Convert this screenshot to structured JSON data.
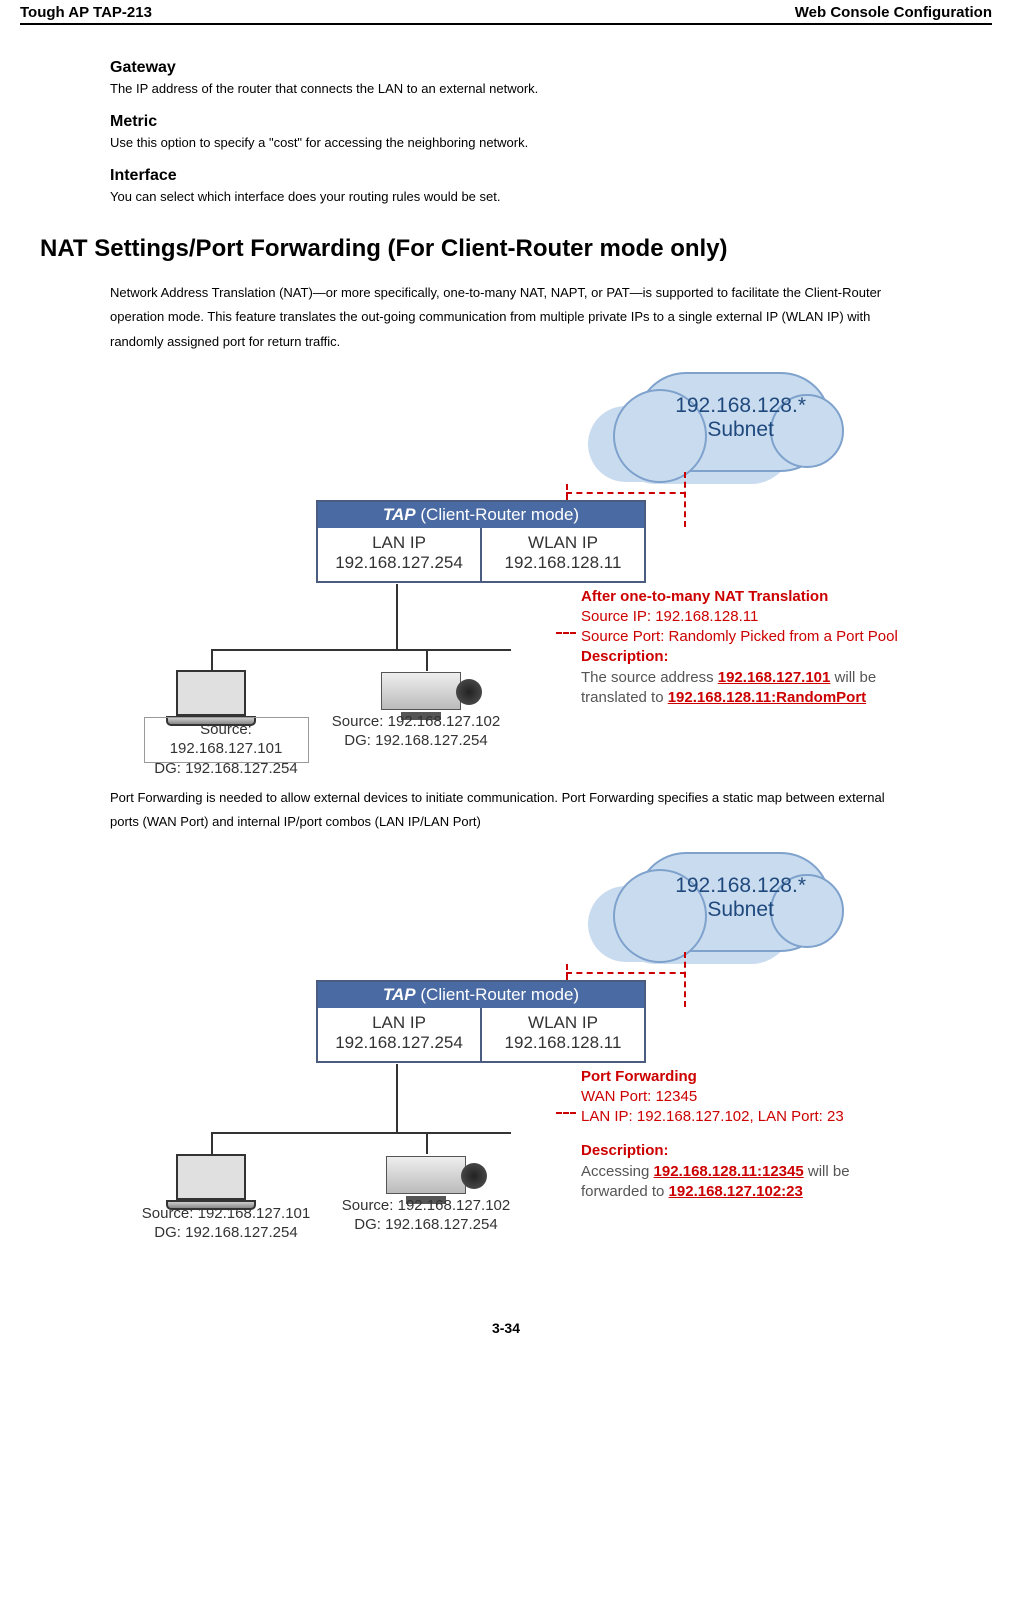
{
  "header": {
    "left": "Tough AP TAP-213",
    "right": "Web Console Configuration"
  },
  "sections": {
    "gateway": {
      "title": "Gateway",
      "text": "The IP address of the router that connects the LAN to an external network."
    },
    "metric": {
      "title": "Metric",
      "text": "Use this option to specify a \"cost\" for accessing the neighboring network."
    },
    "interface": {
      "title": "Interface",
      "text": "You can select which interface does your routing rules would be set."
    }
  },
  "main_heading": "NAT Settings/Port Forwarding (For Client-Router mode only)",
  "para1": "Network Address Translation (NAT)—or more specifically, one-to-many NAT, NAPT, or PAT—is supported to facilitate the Client-Router operation mode. This feature translates the out-going communication from multiple private IPs to a single external IP (WLAN IP) with randomly assigned port for return traffic.",
  "para2": "Port Forwarding is needed to allow external devices to initiate communication. Port Forwarding specifies a static map between external ports (WAN Port) and internal IP/port combos (LAN IP/LAN Port)",
  "diagram": {
    "cloud_line1": "192.168.128.*",
    "cloud_line2": "Subnet",
    "tap_prefix": "TAP",
    "tap_mode": "(Client-Router mode)",
    "lan_label": "LAN IP",
    "lan_ip": "192.168.127.254",
    "wlan_label": "WLAN IP",
    "wlan_ip": "192.168.128.11",
    "dev1_l1": "Source: 192.168.127.101",
    "dev1_l2": "DG: 192.168.127.254",
    "dev2_l1": "Source: 192.168.127.102",
    "dev2_l2": "DG: 192.168.127.254"
  },
  "ann1": {
    "title": "After one-to-many NAT Translation",
    "l1": "Source IP: 192.168.128.11",
    "l2": "Source Port: Randomly Picked from a Port Pool",
    "desc_label": "Description:",
    "d1a": "The source address ",
    "d1b": "192.168.127.101",
    "d1c": " will be",
    "d2a": "translated to ",
    "d2b": "192.168.128.11:RandomPort"
  },
  "ann2": {
    "title": "Port Forwarding",
    "l1": "WAN Port: 12345",
    "l2": "LAN IP: 192.168.127.102, LAN Port: 23",
    "desc_label": "Description:",
    "d1a": "Accessing ",
    "d1b": "192.168.128.11:12345",
    "d1c": " will be",
    "d2a": "forwarded to ",
    "d2b": "192.168.127.102:23"
  },
  "page_number": "3-34"
}
